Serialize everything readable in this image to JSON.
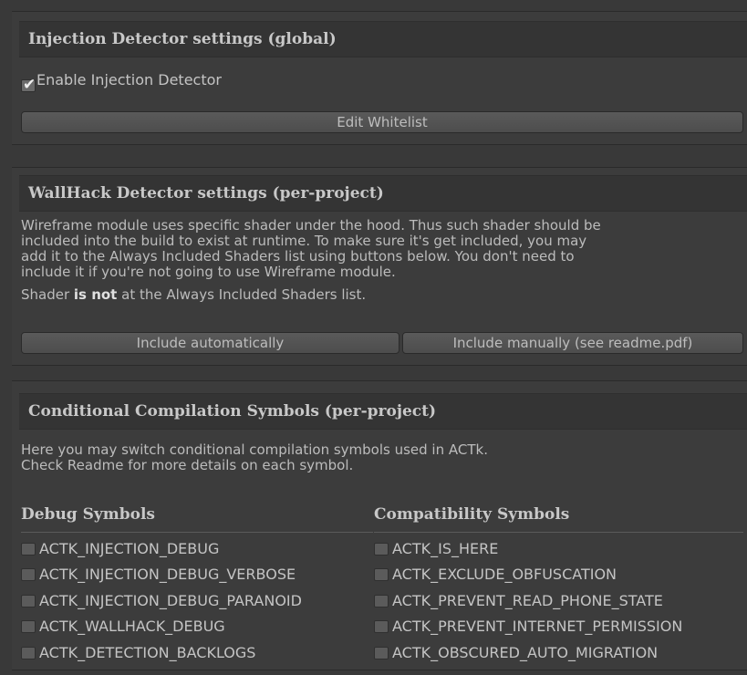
{
  "injection": {
    "title": "Injection Detector settings (global)",
    "enable_label": "Enable Injection Detector",
    "enable_checked": true,
    "whitelist_button": "Edit Whitelist"
  },
  "wallhack": {
    "title": "WallHack Detector settings (per-project)",
    "description": [
      "Wireframe module uses specific shader under the hood. Thus such shader should be",
      "included into the build to exist at runtime. To make sure it's get included, you may",
      "add it to the Always Included Shaders list using buttons below. You don't need to",
      "include it if you're not going to use Wireframe module."
    ],
    "status_prefix": "Shader ",
    "status_bold": "is not",
    "status_suffix": " at the Always Included Shaders list.",
    "include_auto_button": "Include automatically",
    "include_manual_button": "Include manually (see readme.pdf)"
  },
  "symbols": {
    "title": "Conditional Compilation Symbols (per-project)",
    "description": [
      "Here you may switch conditional compilation symbols used in ACTk.",
      "Check Readme for more details on each symbol."
    ],
    "debug_title": "Debug Symbols",
    "compat_title": "Compatibility Symbols",
    "debug": [
      "ACTK_INJECTION_DEBUG",
      "ACTK_INJECTION_DEBUG_VERBOSE",
      "ACTK_INJECTION_DEBUG_PARANOID",
      "ACTK_WALLHACK_DEBUG",
      "ACTK_DETECTION_BACKLOGS"
    ],
    "compat": [
      "ACTK_IS_HERE",
      "ACTK_EXCLUDE_OBFUSCATION",
      "ACTK_PREVENT_READ_PHONE_STATE",
      "ACTK_PREVENT_INTERNET_PERMISSION",
      "ACTK_OBSCURED_AUTO_MIGRATION"
    ]
  }
}
